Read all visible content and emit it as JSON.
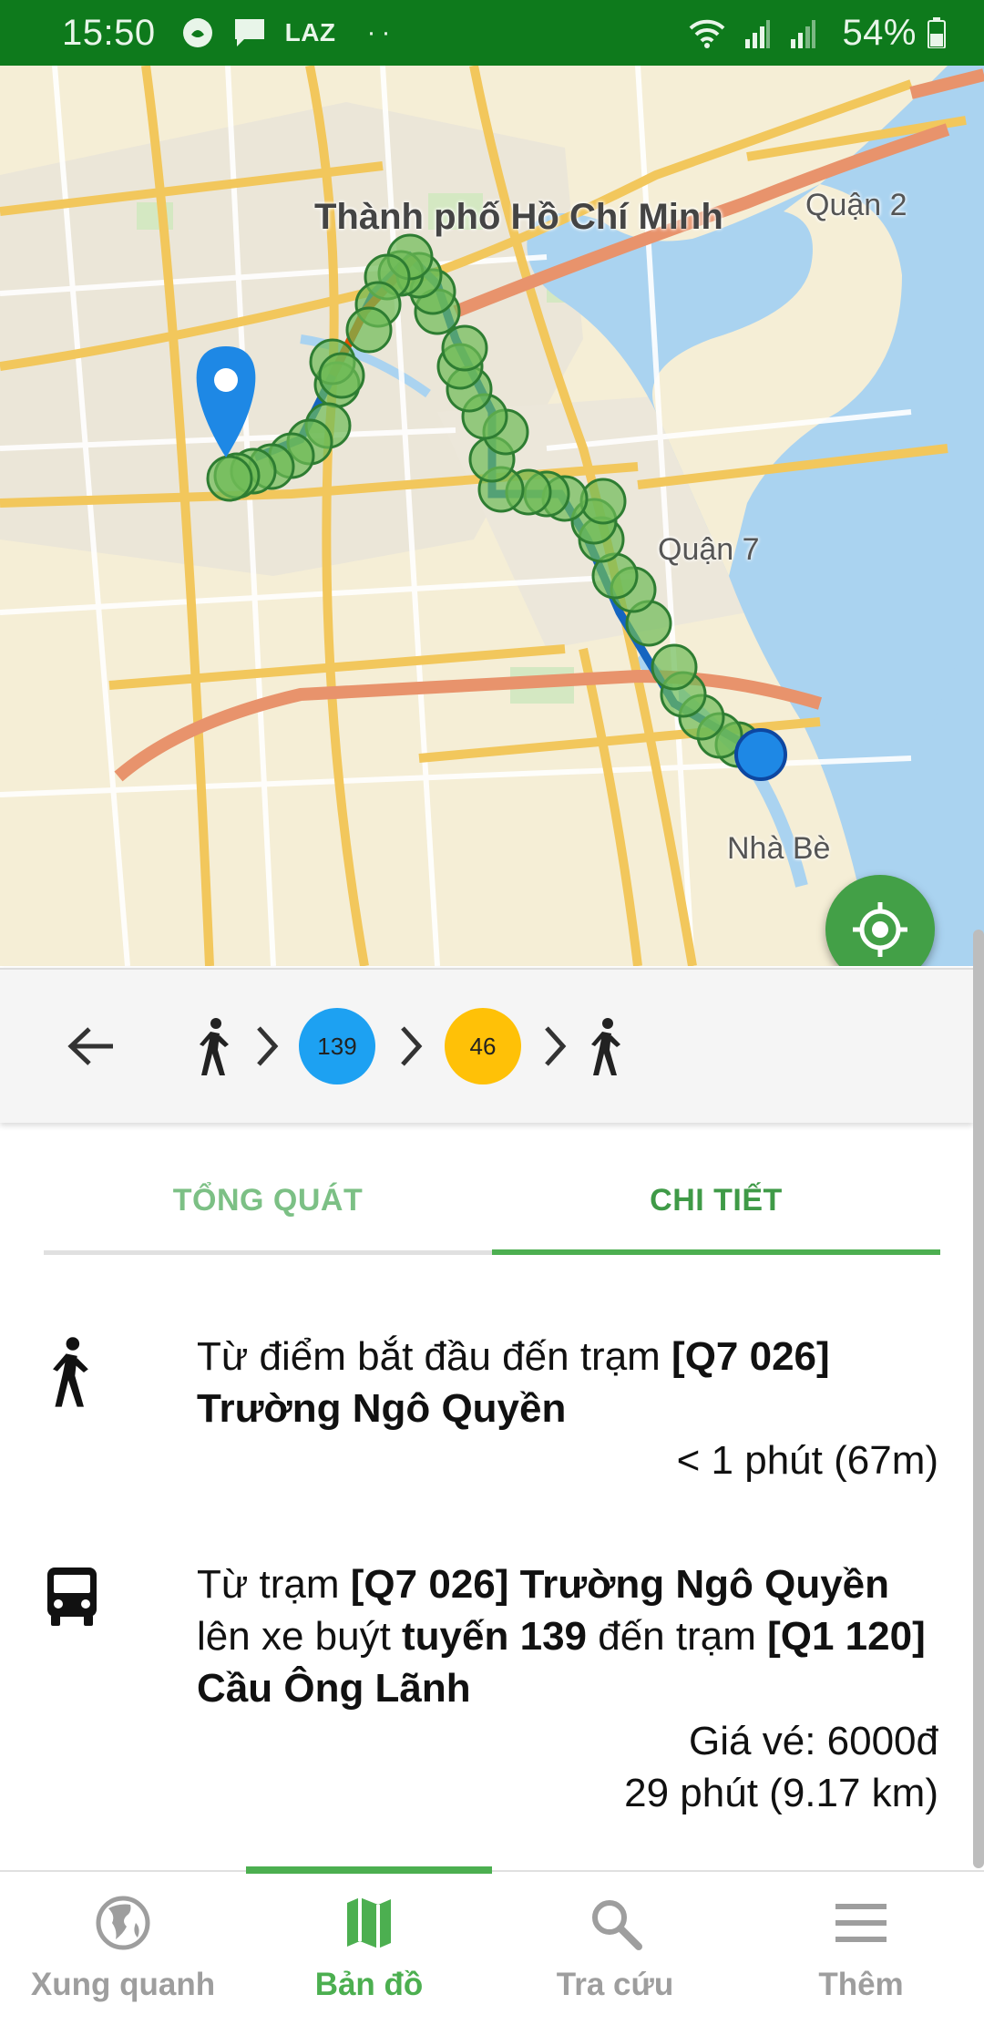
{
  "status_bar": {
    "time": "15:50",
    "notification_icons": [
      "bubble-icon",
      "chat-icon"
    ],
    "lazada_text": "LAZ",
    "more_dots": "··",
    "battery": "54%",
    "background": "#0e7a1c"
  },
  "map": {
    "labels": {
      "city": "Thành phố Hồ Chí Minh",
      "district2": "Quận 2",
      "district7": "Quận 7",
      "nhabe": "Nhà Bè"
    },
    "route_color": "#1565c0",
    "stop_marker_color": "#6dbb55",
    "pin_color": "#1e88e5"
  },
  "route_summary": {
    "steps": [
      "walk",
      "bus",
      "bus",
      "walk"
    ],
    "bus1": {
      "number": "139",
      "color": "#1da1f2"
    },
    "bus2": {
      "number": "46",
      "color": "#ffc107"
    }
  },
  "tabs": [
    {
      "label": "TỔNG QUÁT",
      "active": false
    },
    {
      "label": "CHI TIẾT",
      "active": true
    }
  ],
  "steps": [
    {
      "type": "walk",
      "text_prefix": "Từ điểm bắt đầu đến trạm ",
      "text_bold": "[Q7 026] Trường Ngô Quyền",
      "duration": "< 1 phút (67m)"
    },
    {
      "type": "bus",
      "text_a": "Từ trạm ",
      "text_b": "[Q7 026] Trường Ngô Quyền",
      "text_c": " lên xe buýt ",
      "text_d": "tuyến 139",
      "text_e": " đến trạm ",
      "text_f": "[Q1 120] Cầu Ông Lãnh",
      "fare": "Giá vé: 6000đ",
      "duration": "29 phút (9.17 km)"
    }
  ],
  "bottom_nav": [
    {
      "label": "Xung quanh",
      "icon": "globe-icon",
      "active": false
    },
    {
      "label": "Bản đồ",
      "icon": "map-icon",
      "active": true
    },
    {
      "label": "Tra cứu",
      "icon": "search-icon",
      "active": false
    },
    {
      "label": "Thêm",
      "icon": "menu-icon",
      "active": false
    }
  ],
  "colors": {
    "accent": "#4caf50",
    "inactive": "#9e9e9e"
  }
}
